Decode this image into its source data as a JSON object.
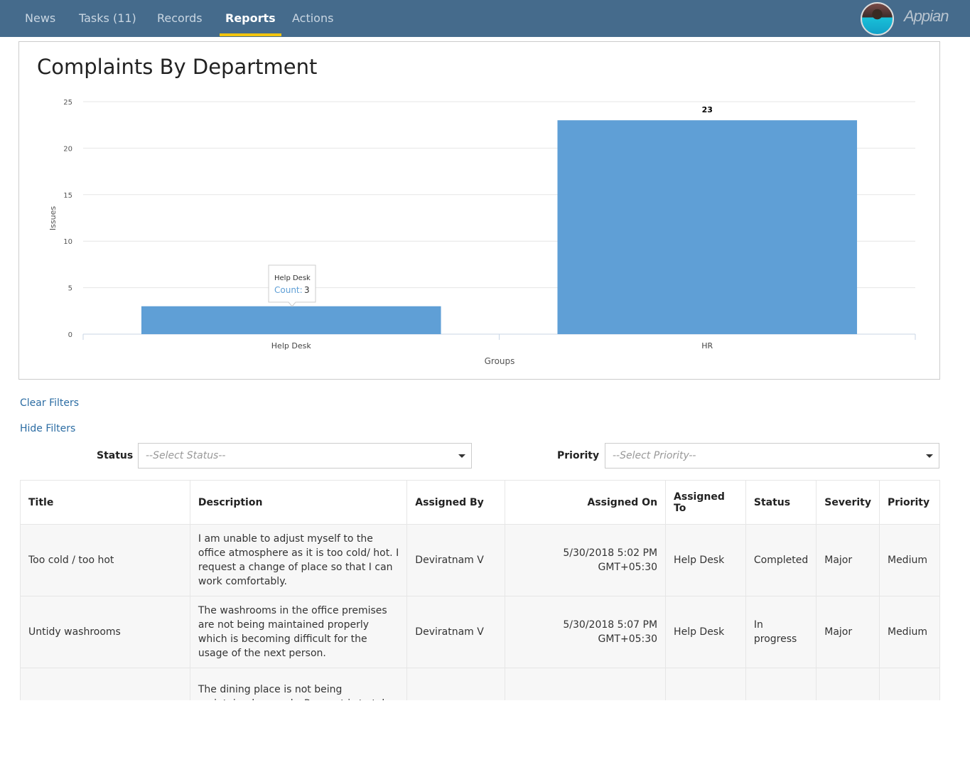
{
  "nav": {
    "tabs": [
      {
        "label": "News"
      },
      {
        "label": "Tasks (11)"
      },
      {
        "label": "Records"
      },
      {
        "label": "Reports",
        "active": true
      },
      {
        "label": "Actions"
      }
    ],
    "logo": "Appian",
    "accent": "#f1c40f",
    "bar_color": "#456b8c"
  },
  "chart": {
    "title": "Complaints By Department"
  },
  "chart_data": {
    "type": "bar",
    "title": "Complaints By Department",
    "xlabel": "Groups",
    "ylabel": "Issues",
    "categories": [
      "Help Desk",
      "HR"
    ],
    "values": [
      3,
      23
    ],
    "ylim": [
      0,
      25
    ],
    "yticks": [
      "0",
      "5",
      "10",
      "15",
      "20",
      "25"
    ],
    "grid": true,
    "color": "#5f9fd6",
    "data_labels": [
      "",
      "23"
    ],
    "tooltip": {
      "title": "Help Desk",
      "label": "Count:",
      "value": "3"
    }
  },
  "filters": {
    "clear": "Clear Filters",
    "hide": "Hide Filters",
    "status_label": "Status",
    "status_placeholder": "--Select Status--",
    "priority_label": "Priority",
    "priority_placeholder": "--Select Priority--"
  },
  "table": {
    "headers": [
      "Title",
      "Description",
      "Assigned By",
      "Assigned On",
      "Assigned To",
      "Status",
      "Severity",
      "Priority"
    ],
    "rows": [
      [
        "Too cold / too hot",
        "I am unable to adjust myself to the office atmosphere as it is too cold/ hot. I request a change of place so that I can work comfortably.",
        "Deviratnam V",
        "5/30/2018 5:02 PM GMT+05:30",
        "Help Desk",
        "Completed",
        "Major",
        "Medium"
      ],
      [
        "Untidy washrooms",
        "The washrooms in the office premises are not being maintained properly which is becoming difficult for the usage of the next person.",
        "Deviratnam V",
        "5/30/2018 5:07 PM GMT+05:30",
        "Help Desk",
        "In progress",
        "Major",
        "Medium"
      ],
      [
        "",
        "The dining place is not being maintained properly. Request is to take an action",
        "",
        "",
        "",
        "",
        "",
        ""
      ]
    ]
  }
}
